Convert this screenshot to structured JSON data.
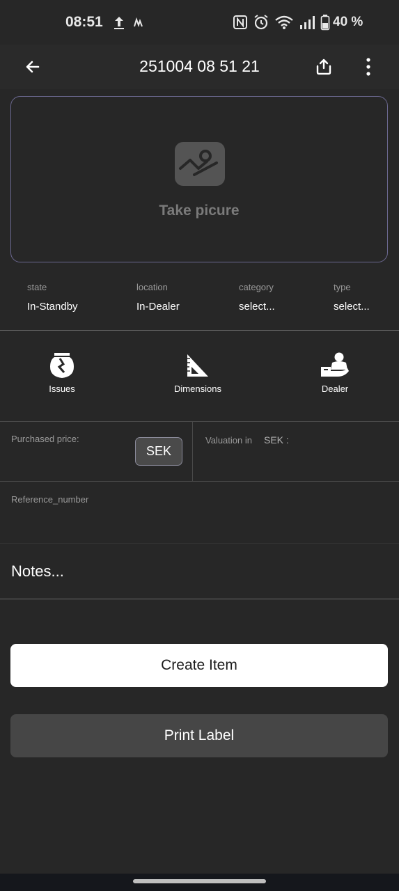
{
  "status_bar": {
    "time": "08:51",
    "battery": "40 %",
    "icons": [
      "upload-icon",
      "gesture-icon",
      "nfc-icon",
      "alarm-icon",
      "wifi-icon",
      "signal-icon",
      "battery-icon"
    ]
  },
  "app_bar": {
    "title": "251004 08 51 21",
    "icons": [
      "back-arrow-icon",
      "share-icon",
      "more-vert-icon"
    ]
  },
  "photo": {
    "label": "Take picure",
    "icon": "image-placeholder-icon"
  },
  "meta": {
    "state_label": "state",
    "state_value": "In-Standby",
    "location_label": "location",
    "location_value": "In-Dealer",
    "category_label": "category",
    "category_value": "select...",
    "type_label": "type",
    "type_value": "select..."
  },
  "actions": {
    "issues": "Issues",
    "dimensions": "Dimensions",
    "dealer": "Dealer",
    "icons": [
      "broken-vase-icon",
      "ruler-triangle-icon",
      "dealer-person-icon"
    ]
  },
  "fields": {
    "purchased_price_label": "Purchased price:",
    "currency_button": "SEK",
    "valuation_label": "Valuation in",
    "valuation_currency": "SEK :",
    "reference_label": "Reference_number",
    "notes_placeholder": "Notes..."
  },
  "buttons": {
    "create": "Create Item",
    "print": "Print Label"
  },
  "colors": {
    "background": "#272727",
    "card_border": "#6b6890",
    "primary_button": "#ffffff",
    "secondary_button": "#464646"
  }
}
